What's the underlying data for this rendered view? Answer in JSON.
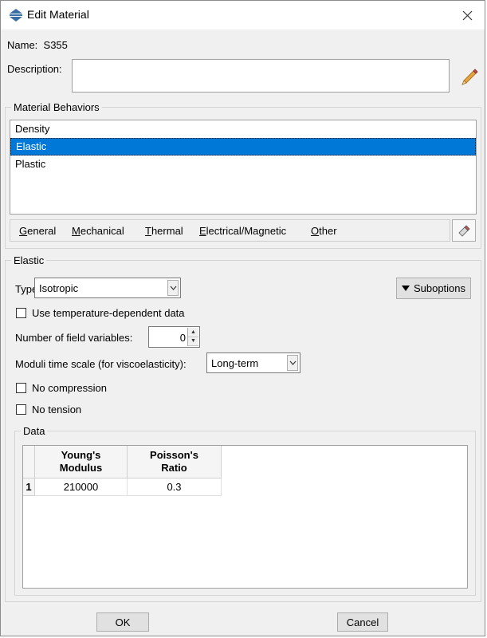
{
  "window": {
    "title": "Edit Material"
  },
  "material": {
    "name_label": "Name:",
    "name_value": "S355",
    "description_label": "Description:",
    "description_value": ""
  },
  "behaviors": {
    "group_title": "Material Behaviors",
    "items": [
      {
        "label": "Density"
      },
      {
        "label": "Elastic"
      },
      {
        "label": "Plastic"
      }
    ],
    "selected": "Elastic"
  },
  "menus": [
    {
      "label": "General",
      "mnemonic": "G"
    },
    {
      "label": "Mechanical",
      "mnemonic": "M"
    },
    {
      "label": "Thermal",
      "mnemonic": "T"
    },
    {
      "label": "Electrical/Magnetic",
      "mnemonic": "E"
    },
    {
      "label": "Other",
      "mnemonic": "O"
    }
  ],
  "elastic": {
    "group_title": "Elastic",
    "type_label": "Type:",
    "type_value": "Isotropic",
    "suboptions_label": "Suboptions",
    "temp_dependent_label": "Use temperature-dependent data",
    "field_vars_label": "Number of field variables:",
    "field_vars_value": "0",
    "moduli_label": "Moduli time scale (for viscoelasticity):",
    "moduli_value": "Long-term",
    "no_compression_label": "No compression",
    "no_tension_label": "No tension"
  },
  "data_table": {
    "group_title": "Data",
    "columns": [
      "Young's\nModulus",
      "Poisson's\nRatio"
    ],
    "rows": [
      {
        "index": "1",
        "cells": [
          "210000",
          "0.3"
        ]
      }
    ]
  },
  "buttons": {
    "ok": "OK",
    "cancel": "Cancel"
  },
  "colors": {
    "selection": "#0078d7",
    "icon_blue": "#3a6ea5",
    "pencil": "#e8a33c"
  }
}
